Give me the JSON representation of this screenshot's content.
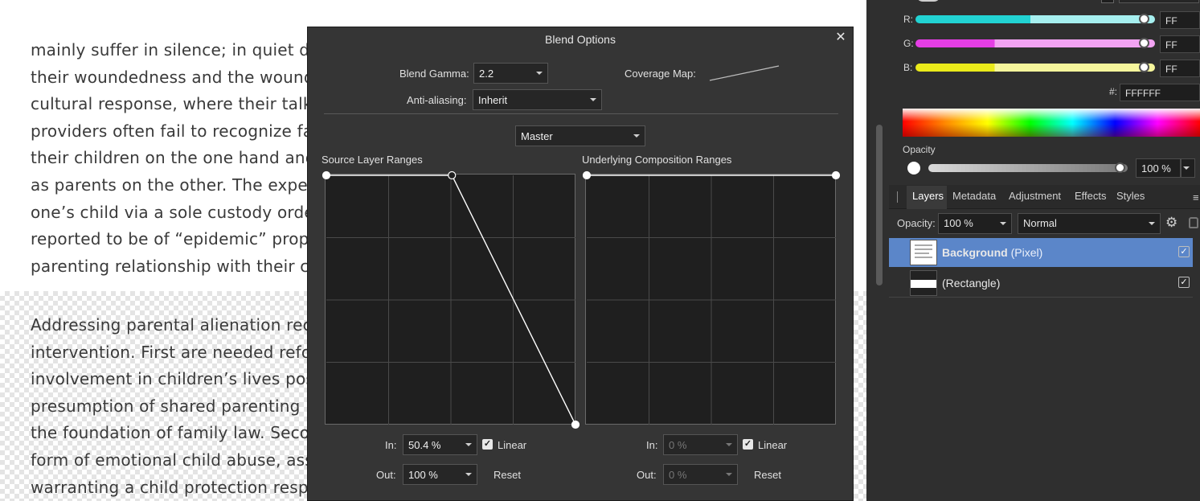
{
  "document": {
    "paragraph1": [
      "mainly suffer in silence; in quiet de",
      "their woundedness and the wound",
      "cultural response, where their talk",
      "providers often fail to recognize fa",
      "their children on the one hand and",
      "as parents on the other. The exper",
      "one’s child via a sole custody order",
      "reported to be of “epidemic” propo",
      "parenting relationship with their c"
    ],
    "paragraph2": [
      "Addressing parental alienation rec",
      "intervention. First are needed refo",
      "involvement in children’s lives pos",
      "presumption of shared parenting i",
      "the foundation of family law. Secor",
      "form of emotional child abuse, assu",
      "warranting a child protection resp"
    ]
  },
  "color_panel": {
    "r_label": "R:",
    "g_label": "G:",
    "b_label": "B:",
    "r_value": "FF",
    "g_value": "FF",
    "b_value": "FF",
    "hex_label": "#:",
    "hex_value": "FFFFFF",
    "opacity_label": "Opacity",
    "opacity_value": "100 %",
    "opacity_level": 1.0,
    "r_level": 1.0,
    "g_level": 1.0,
    "b_level": 1.0
  },
  "tabs": [
    "Layers",
    "Metadata",
    "Adjustment",
    "Effects",
    "Styles"
  ],
  "layers_panel": {
    "opacity_label": "Opacity:",
    "opacity_value": "100 %",
    "blend_mode": "Normal",
    "layers": [
      {
        "name": "Background",
        "type": "(Pixel)",
        "selected": true,
        "visible": true
      },
      {
        "name": "",
        "type": "(Rectangle)",
        "selected": false,
        "visible": true
      }
    ]
  },
  "dialog": {
    "title": "Blend Options",
    "close_icon": "close-icon",
    "blend_gamma_label": "Blend Gamma:",
    "blend_gamma_value": "2.2",
    "coverage_map_label": "Coverage Map:",
    "antialiasing_label": "Anti-aliasing:",
    "antialiasing_value": "Inherit",
    "channel_value": "Master",
    "source": {
      "title": "Source Layer Ranges",
      "in_label": "In:",
      "in_value": "50.4 %",
      "linear_label": "Linear",
      "linear_checked": true,
      "out_label": "Out:",
      "out_value": "100 %",
      "reset_label": "Reset",
      "curve_points": [
        [
          0,
          1
        ],
        [
          0.504,
          1
        ],
        [
          1,
          0
        ]
      ]
    },
    "underlying": {
      "title": "Underlying Composition Ranges",
      "in_label": "In:",
      "in_value": "0 %",
      "linear_label": "Linear",
      "linear_checked": true,
      "out_label": "Out:",
      "out_value": "0 %",
      "reset_label": "Reset",
      "curve_points": [
        [
          0,
          1
        ],
        [
          1,
          1
        ]
      ]
    }
  },
  "colors": {
    "selection": "#5b86c9",
    "dialog_bg": "#353535",
    "panel_bg": "#2f2f2f"
  }
}
